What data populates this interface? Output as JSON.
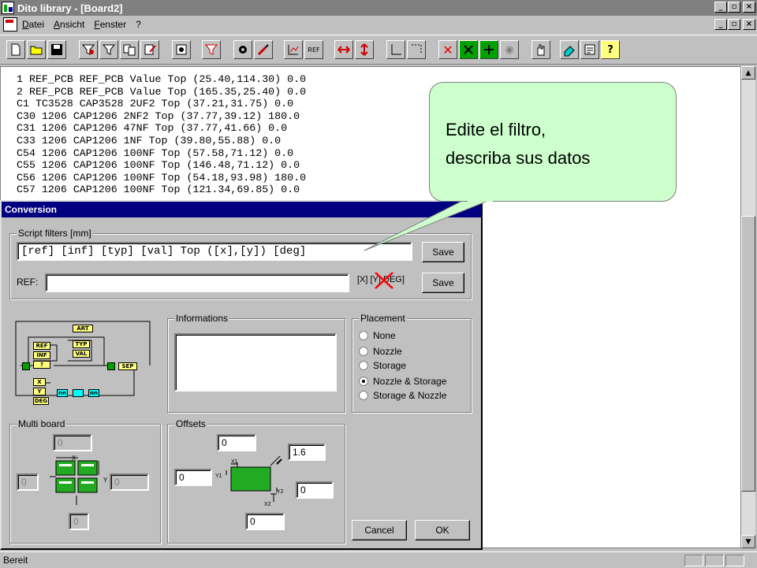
{
  "window": {
    "title": "Dito library - [Board2]"
  },
  "menu": {
    "items": [
      "Datei",
      "Ansicht",
      "Fenster",
      "?"
    ]
  },
  "code": {
    "lines": [
      "1 REF_PCB REF_PCB Value Top (25.40,114.30) 0.0",
      "2 REF_PCB REF_PCB Value Top (165.35,25.40) 0.0",
      "C1 TC3528 CAP3528 2UF2 Top (37.21,31.75) 0.0",
      "C30 1206 CAP1206 2NF2 Top (37.77,39.12) 180.0",
      "C31 1206 CAP1206 47NF Top (37.77,41.66) 0.0",
      "C33 1206 CAP1206 1NF Top (39.80,55.88) 0.0",
      "C54 1206 CAP1206 100NF Top (57.58,71.12) 0.0",
      "C55 1206 CAP1206 100NF Top (146.48,71.12) 0.0",
      "C56 1206 CAP1206 100NF Top (54.18,93.98) 180.0",
      "C57 1206 CAP1206 100NF Top (121.34,69.85) 0.0"
    ]
  },
  "status": {
    "text": "Bereit"
  },
  "dialog": {
    "title": "Conversion",
    "script_filters": {
      "label": "Script filters [mm]",
      "filter_value": "[ref] [inf] [typ] [val] Top ([x],[y]) [deg]",
      "save_label": "Save",
      "ref_label": "REF:",
      "ref_value": "",
      "ref_options": "[X] [Y] DEG]",
      "save2_label": "Save"
    },
    "diagram": {
      "boxes": [
        "ART",
        "REF",
        "INF",
        "?",
        "TYP",
        "VAL",
        "X",
        "Y",
        "DEG",
        "nn",
        "nn",
        "SEP"
      ]
    },
    "informations": {
      "label": "Informations",
      "value": ""
    },
    "placement": {
      "label": "Placement",
      "options": [
        "None",
        "Nozzle",
        "Storage",
        "Nozzle & Storage",
        "Storage & Nozzle"
      ],
      "selected_index": 3
    },
    "multi_board": {
      "label": "Multi board",
      "top_value": "0",
      "left_value": "0",
      "right_value": "0",
      "bottom_value": "0",
      "x_label": "X",
      "y_label": "Y"
    },
    "offsets": {
      "label": "Offsets",
      "top_value": "0",
      "thickness_value": "1.6",
      "left_value": "0",
      "right_value": "0",
      "bottom_value": "0",
      "x1_label": "X1",
      "y1_label": "Y1",
      "y2_label": "Y2",
      "x2_label": "X2"
    },
    "cancel_label": "Cancel",
    "ok_label": "OK"
  },
  "callout": {
    "line1": "Edite el filtro,",
    "line2": "describa sus datos"
  },
  "colors": {
    "title_inactive": "#808080",
    "dialog_title": "#000080",
    "callout_fill": "#ccffcc",
    "pcb_green": "#22aa22",
    "diagram_yellow": "#ffff80",
    "diagram_green": "#00a000",
    "diagram_cyan": "#00ffff",
    "annotation_red": "#ff0000"
  }
}
